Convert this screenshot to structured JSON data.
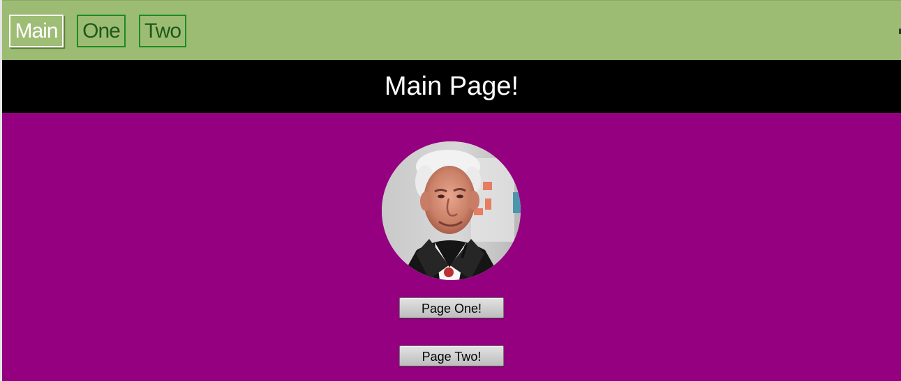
{
  "nav": {
    "tabs": [
      {
        "label": "Main",
        "active": true
      },
      {
        "label": "One",
        "active": false
      },
      {
        "label": "Two",
        "active": false
      }
    ]
  },
  "header": {
    "title": "Main Page!"
  },
  "content": {
    "buttons": {
      "page_one": "Page One!",
      "page_two": "Page Two!"
    }
  },
  "colors": {
    "nav_background": "#9dbc73",
    "nav_tab_border": "#1d8a25",
    "active_tab": "#ffffff",
    "header_background": "#000000",
    "content_background": "#940080",
    "button_background": "#d3d3d3"
  }
}
